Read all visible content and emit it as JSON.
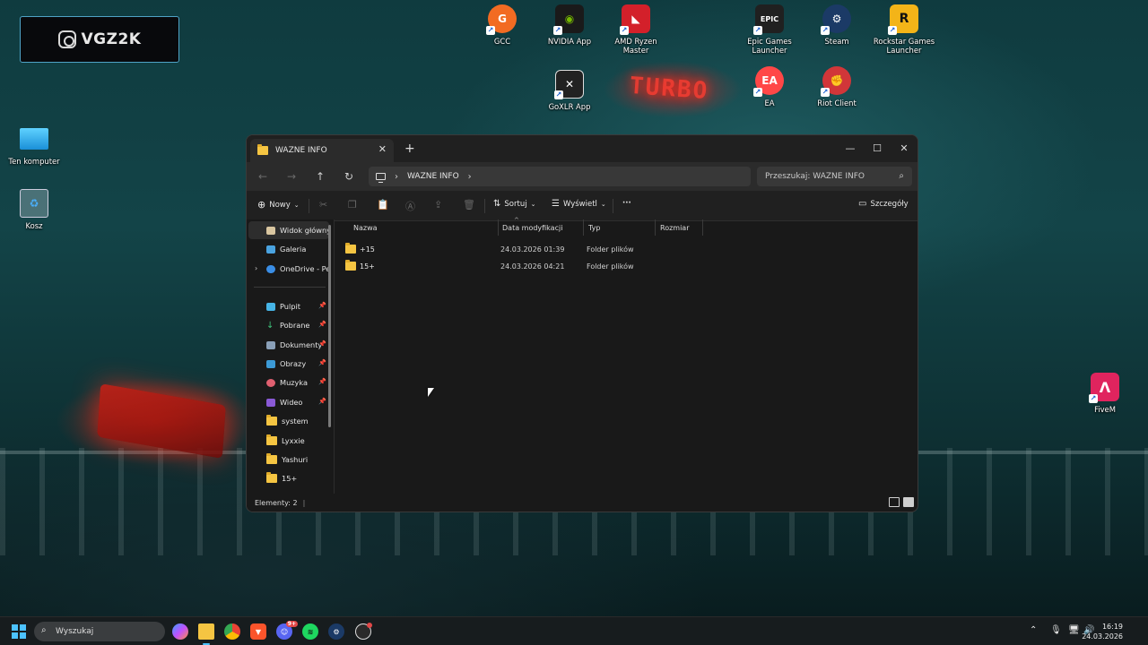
{
  "widget": {
    "logo_text": "VGZ2K"
  },
  "desktop_icons": [
    {
      "label": "GCC"
    },
    {
      "label": "NVIDIA App"
    },
    {
      "label": "AMD Ryzen Master"
    },
    {
      "label": "Epic Games Launcher"
    },
    {
      "label": "Steam"
    },
    {
      "label": "Rockstar Games Launcher"
    },
    {
      "label": "GoXLR App"
    },
    {
      "label": "EA"
    },
    {
      "label": "Riot Client"
    },
    {
      "label": "Ten komputer"
    },
    {
      "label": "Kosz"
    },
    {
      "label": "FiveM"
    }
  ],
  "explorer": {
    "tab_title": "WAZNE INFO",
    "address": "WAZNE INFO",
    "search_placeholder": "Przeszukaj: WAZNE INFO",
    "toolbar": {
      "new_label": "Nowy",
      "sort_label": "Sortuj",
      "view_label": "Wyświetl",
      "more_label": "···",
      "details_label": "Szczegóły"
    },
    "nav": [
      {
        "label": "Widok główny"
      },
      {
        "label": "Galeria"
      },
      {
        "label": "OneDrive - Personal"
      },
      {
        "label": "Pulpit"
      },
      {
        "label": "Pobrane"
      },
      {
        "label": "Dokumenty"
      },
      {
        "label": "Obrazy"
      },
      {
        "label": "Muzyka"
      },
      {
        "label": "Wideo"
      },
      {
        "label": "system"
      },
      {
        "label": "Lyxxie"
      },
      {
        "label": "Yashuri"
      },
      {
        "label": "15+"
      }
    ],
    "columns": {
      "name": "Nazwa",
      "date": "Data modyfikacji",
      "type": "Typ",
      "size": "Rozmiar"
    },
    "files": [
      {
        "name": "+15",
        "date": "24.03.2026 01:39",
        "type": "Folder plików"
      },
      {
        "name": "15+",
        "date": "24.03.2026 04:21",
        "type": "Folder plików"
      }
    ],
    "status": "Elementy: 2"
  },
  "taskbar": {
    "search_placeholder": "Wyszukaj",
    "notification_count": "9+",
    "time": "16:19",
    "date": "24.03.2026"
  },
  "colors": {
    "accent": "#4cc2ff",
    "folder": "#f5c542",
    "window_bg": "#191919"
  }
}
